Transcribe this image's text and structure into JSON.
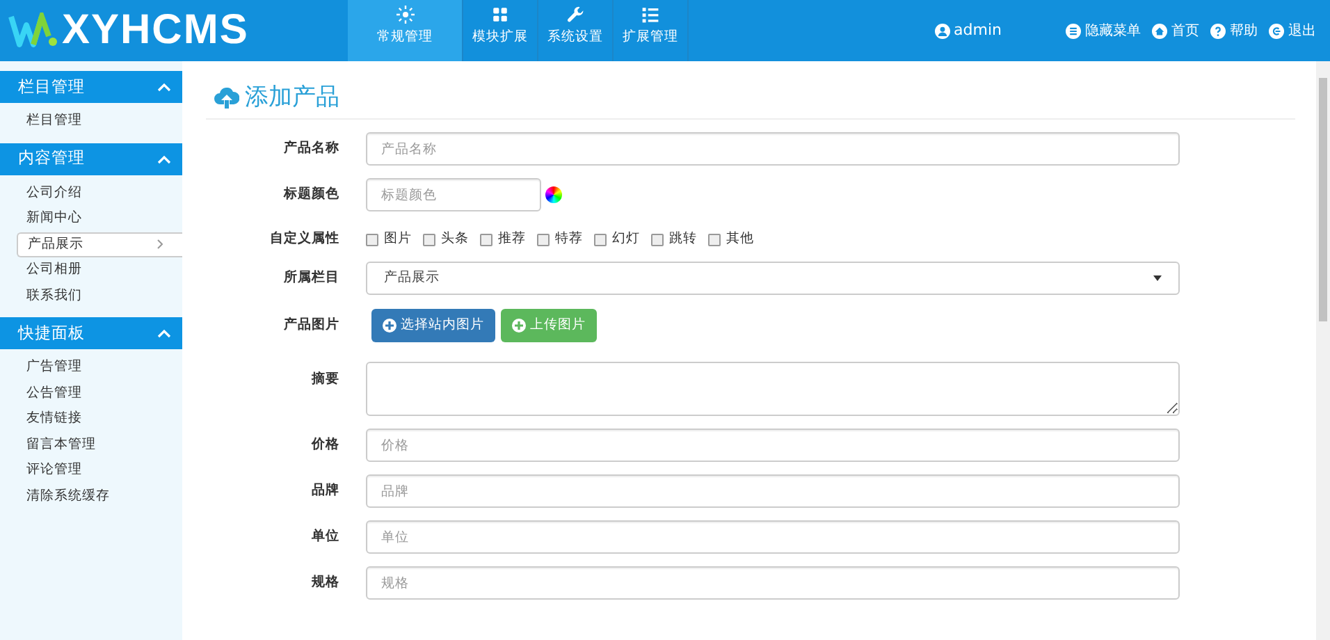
{
  "header": {
    "logo": "XYHCMS",
    "tabs": [
      {
        "label": "常规管理",
        "selected": true
      },
      {
        "label": "模块扩展",
        "selected": false
      },
      {
        "label": "系统设置",
        "selected": false
      },
      {
        "label": "扩展管理",
        "selected": false
      }
    ],
    "user": "admin",
    "links": [
      {
        "label": "隐藏菜单"
      },
      {
        "label": "首页"
      },
      {
        "label": "帮助"
      },
      {
        "label": "退出"
      }
    ]
  },
  "sidebar": {
    "groups": [
      {
        "title": "栏目管理",
        "expanded": true,
        "items": [
          {
            "label": "栏目管理",
            "selected": false
          }
        ]
      },
      {
        "title": "内容管理",
        "expanded": true,
        "items": [
          {
            "label": "公司介绍",
            "selected": false
          },
          {
            "label": "新闻中心",
            "selected": false
          },
          {
            "label": "产品展示",
            "selected": true
          },
          {
            "label": "公司相册",
            "selected": false
          },
          {
            "label": "联系我们",
            "selected": false
          }
        ]
      },
      {
        "title": "快捷面板",
        "expanded": true,
        "items": [
          {
            "label": "广告管理",
            "selected": false
          },
          {
            "label": "公告管理",
            "selected": false
          },
          {
            "label": "友情链接",
            "selected": false
          },
          {
            "label": "留言本管理",
            "selected": false
          },
          {
            "label": "评论管理",
            "selected": false
          },
          {
            "label": "清除系统缓存",
            "selected": false
          }
        ]
      }
    ]
  },
  "form": {
    "title": "添加产品",
    "fields": [
      {
        "kind": "text",
        "label": "产品名称",
        "placeholder": "产品名称"
      },
      {
        "kind": "color",
        "label": "标题颜色",
        "placeholder": "标题颜色"
      },
      {
        "kind": "checkboxes",
        "label": "自定义属性",
        "options": [
          {
            "label": "图片",
            "checked": false
          },
          {
            "label": "头条",
            "checked": false
          },
          {
            "label": "推荐",
            "checked": false
          },
          {
            "label": "特荐",
            "checked": false
          },
          {
            "label": "幻灯",
            "checked": false
          },
          {
            "label": "跳转",
            "checked": false
          },
          {
            "label": "其他",
            "checked": false
          }
        ]
      },
      {
        "kind": "select",
        "label": "所属栏目",
        "value": "产品展示"
      },
      {
        "kind": "buttons",
        "label": "产品图片",
        "buttons": [
          {
            "label": "选择站内图片"
          },
          {
            "label": "上传图片"
          }
        ]
      },
      {
        "kind": "textarea",
        "label": "摘要"
      },
      {
        "kind": "text",
        "label": "价格",
        "placeholder": "价格"
      },
      {
        "kind": "text",
        "label": "品牌",
        "placeholder": "品牌"
      },
      {
        "kind": "text",
        "label": "单位",
        "placeholder": "单位"
      },
      {
        "kind": "text",
        "label": "规格",
        "placeholder": "规格"
      }
    ]
  }
}
